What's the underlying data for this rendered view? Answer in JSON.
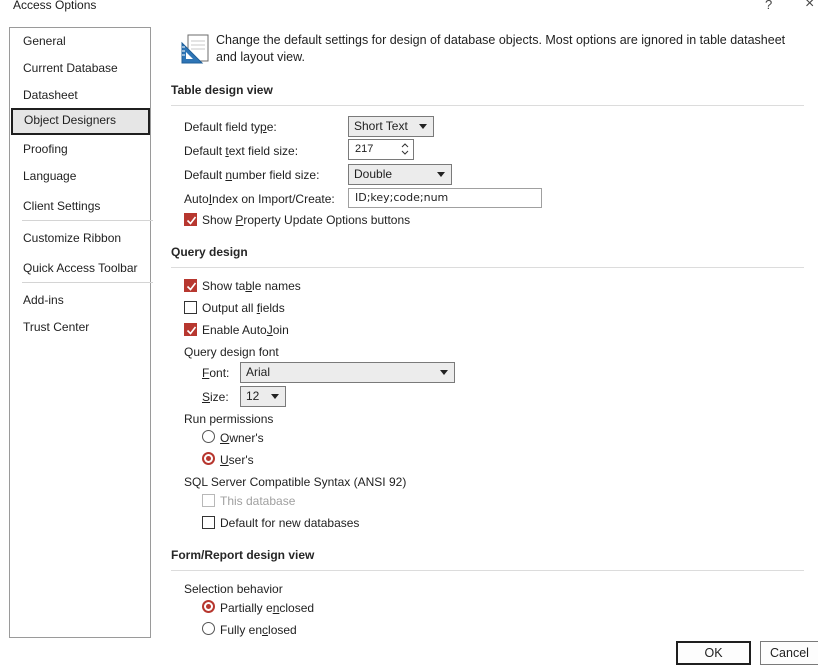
{
  "window": {
    "title": "Access Options",
    "help_label": "?",
    "close_label": "×"
  },
  "sidebar": {
    "items": [
      {
        "label": "General"
      },
      {
        "label": "Current Database"
      },
      {
        "label": "Datasheet"
      },
      {
        "label": "Object Designers",
        "active": true
      },
      {
        "label": "Proofing"
      },
      {
        "label": "Language"
      },
      {
        "label": "Client Settings"
      },
      {
        "label": "Customize Ribbon"
      },
      {
        "label": "Quick Access Toolbar"
      },
      {
        "label": "Add-ins"
      },
      {
        "label": "Trust Center"
      }
    ]
  },
  "intro": {
    "text": "Change the default settings for design of database objects. Most options are ignored in table datasheet and layout view.",
    "icon": "design-ruler-icon"
  },
  "table_design": {
    "title": "Table design view",
    "field_type": {
      "pre": "Default field ty",
      "key": "p",
      "post": "e:",
      "value": "Short Text"
    },
    "text_field_size": {
      "pre": "Default ",
      "key": "t",
      "post": "ext field size:",
      "value": "217"
    },
    "number_field_size": {
      "pre": "Default ",
      "key": "n",
      "post": "umber field size:",
      "value": "Double"
    },
    "autoindex": {
      "pre": "Auto",
      "key": "I",
      "post": "ndex on Import/Create:",
      "value": "ID;key;code;num"
    },
    "show_property": {
      "pre": "Show ",
      "key": "P",
      "post": "roperty Update Options buttons",
      "checked": true
    }
  },
  "query_design": {
    "title": "Query design",
    "show_table_names": {
      "pre": "Show ta",
      "key": "b",
      "post": "le names",
      "checked": true
    },
    "output_all_fields": {
      "pre": "Output all ",
      "key": "f",
      "post": "ields",
      "checked": false
    },
    "enable_autojoin": {
      "pre": "Enable Auto",
      "key": "J",
      "post": "oin",
      "checked": true
    },
    "font_group_label": "Query design font",
    "font": {
      "pre": "",
      "key": "F",
      "post": "ont:",
      "value": "Arial"
    },
    "size": {
      "pre": "",
      "key": "S",
      "post": "ize:",
      "value": "12"
    },
    "run_permissions_label": "Run permissions",
    "owners": {
      "pre": "",
      "key": "O",
      "post": "wner's",
      "checked": false
    },
    "users": {
      "pre": "",
      "key": "U",
      "post": "ser's",
      "checked": true
    },
    "sql_label": "SQL Server Compatible Syntax (ANSI 92)",
    "this_database": {
      "label": "This database",
      "checked": false,
      "disabled": true
    },
    "default_new_db": {
      "label": "Default for new databases",
      "checked": false
    }
  },
  "form_report": {
    "title": "Form/Report design view",
    "selection_label": "Selection behavior",
    "partially": {
      "pre": "Partially e",
      "key": "n",
      "post": "closed",
      "checked": true
    },
    "fully": {
      "pre": "Fully en",
      "key": "c",
      "post": "losed",
      "checked": false
    }
  },
  "buttons": {
    "ok": "OK",
    "cancel": "Cancel"
  },
  "colors": {
    "accent": "#b7372f",
    "border": "#7a7a7a",
    "active_nav_bg": "#e6e6e6"
  }
}
